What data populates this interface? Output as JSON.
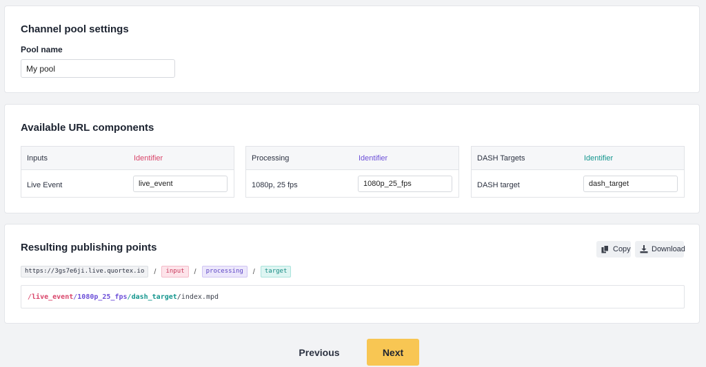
{
  "pool_settings": {
    "title": "Channel pool settings",
    "pool_name_label": "Pool name",
    "pool_name_value": "My pool"
  },
  "url_components": {
    "title": "Available URL components",
    "tables": [
      {
        "header": "Inputs",
        "identifier_label": "Identifier",
        "row_label": "Live Event",
        "identifier_value": "live_event",
        "accent": "#d9456a"
      },
      {
        "header": "Processing",
        "identifier_label": "Identifier",
        "row_label": "1080p, 25 fps",
        "identifier_value": "1080p_25_fps",
        "accent": "#6c4fd8"
      },
      {
        "header": "DASH Targets",
        "identifier_label": "Identifier",
        "row_label": "DASH target",
        "identifier_value": "dash_target",
        "accent": "#14968e"
      }
    ]
  },
  "publishing_points": {
    "title": "Resulting publishing points",
    "copy_label": "Copy",
    "download_label": "Download",
    "base_url": "https://3gs7e6ji.live.quortex.io",
    "separator": "/",
    "chip_input": "input",
    "chip_processing": "processing",
    "chip_target": "target",
    "path": {
      "slash": "/",
      "input": "live_event",
      "processing": "1080p_25_fps",
      "target": "dash_target",
      "file": "index.mpd"
    }
  },
  "footer": {
    "previous_label": "Previous",
    "next_label": "Next",
    "next_color": "#f8c653"
  }
}
